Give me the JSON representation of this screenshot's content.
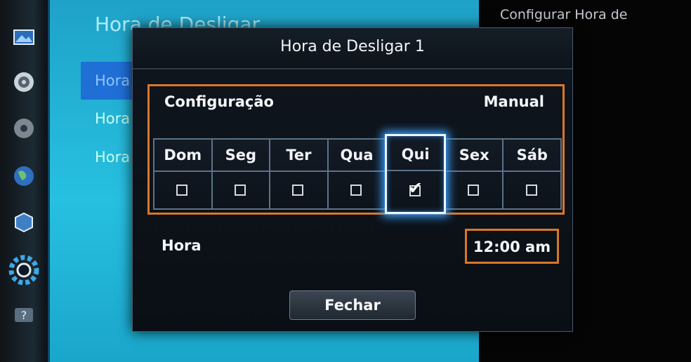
{
  "background_menu": {
    "title": "Hora de Desligar",
    "items": [
      "Hora",
      "Hora",
      "Hora"
    ]
  },
  "info_panel": {
    "text": "Configurar Hora de"
  },
  "dialog": {
    "title": "Hora de Desligar 1",
    "config_label": "Configuração",
    "config_value": "Manual",
    "days": [
      {
        "label": "Dom",
        "checked": false
      },
      {
        "label": "Seg",
        "checked": false
      },
      {
        "label": "Ter",
        "checked": false
      },
      {
        "label": "Qua",
        "checked": false
      },
      {
        "label": "Qui",
        "checked": true
      },
      {
        "label": "Sex",
        "checked": false
      },
      {
        "label": "Sáb",
        "checked": false
      }
    ],
    "selected_day": "Qui",
    "time_label": "Hora",
    "time_value": "12:00 am",
    "close_label": "Fechar"
  },
  "rail_icons": [
    "picture-icon",
    "sound-icon",
    "broadcast-icon",
    "network-icon",
    "smart-hub-icon",
    "settings-icon",
    "support-icon"
  ],
  "colors": {
    "accent_highlight": "#d9772a",
    "selection_glow": "#3aa0ff",
    "menu_bg": "#27c0e0"
  }
}
